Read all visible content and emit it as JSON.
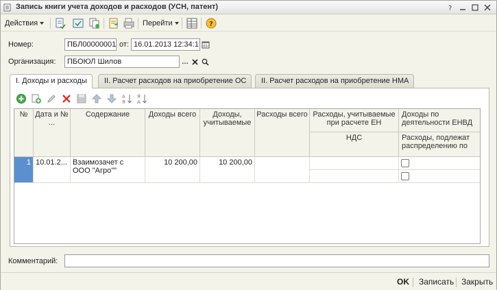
{
  "window": {
    "title": "Запись книги учета доходов и расходов (УСН, патент)"
  },
  "toolbar": {
    "actions_label": "Действия",
    "goto_label": "Перейти"
  },
  "form": {
    "number_label": "Номер:",
    "number_value": "ПБЛ00000001",
    "from_label": "от:",
    "date_value": "16.01.2013 12:34:17",
    "org_label": "Организация:",
    "org_value": "ПБОЮЛ  Шилов",
    "comment_label": "Комментарий:",
    "comment_value": ""
  },
  "tabs": [
    {
      "label": "I. Доходы и расходы"
    },
    {
      "label": "II. Расчет расходов на приобретение ОС"
    },
    {
      "label": "II. Расчет расходов на приобретение НМА"
    }
  ],
  "table": {
    "headers": {
      "num": "№",
      "date": "Дата и № ...",
      "content": "Содержание",
      "income_total": "Доходы всего",
      "income_counted": "Доходы, учитываемые",
      "expense_total": "Расходы всего",
      "expense_en": "Расходы, учитываемые при расчете ЕН",
      "expense_en_sub": "НДС",
      "income_envd": "Доходы по деятельности ЕНВД",
      "income_envd_sub": "Расходы, подлежат распределению по"
    },
    "rows": [
      {
        "num": "1",
        "date": "10.01.2...",
        "content": "Взаимозачет с ООО \"Агро\"\"",
        "income_total": "10 200,00",
        "income_counted": "10 200,00",
        "expense_total": "",
        "expense_en": "",
        "vat": ""
      }
    ]
  },
  "footer": {
    "ok_label": "OK",
    "save_label": "Записать",
    "close_label": "Закрыть"
  }
}
